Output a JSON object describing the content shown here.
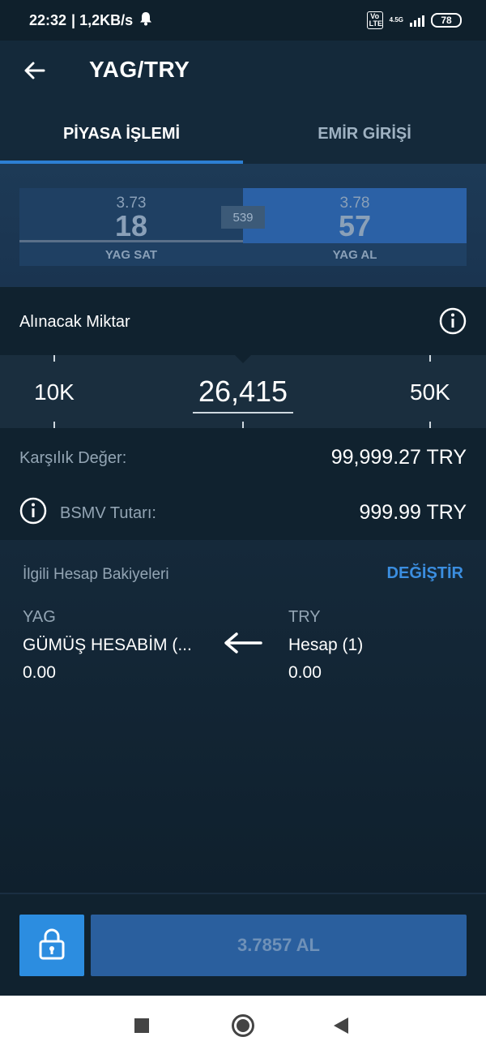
{
  "status_bar": {
    "time": "22:32",
    "network_speed": "| 1,2KB/s",
    "volte_label": "Vo LTE",
    "network_type": "4.5G",
    "battery": "78"
  },
  "header": {
    "title": "YAG/TRY"
  },
  "tabs": [
    {
      "label": "PİYASA İŞLEMİ",
      "active": true
    },
    {
      "label": "EMİR GİRİŞİ",
      "active": false
    }
  ],
  "quote": {
    "sell": {
      "price": "3.73",
      "pips": "18",
      "label": "YAG SAT"
    },
    "buy": {
      "price": "3.78",
      "pips": "57",
      "label": "YAG AL"
    },
    "spread": "539"
  },
  "amount": {
    "label": "Alınacak Miktar",
    "min": "10K",
    "max": "50K",
    "value": "26,415"
  },
  "values": {
    "counter_label": "Karşılık Değer:",
    "counter_value": "99,999.27 TRY",
    "bsmv_label": "BSMV Tutarı:",
    "bsmv_value": "999.99 TRY"
  },
  "balances": {
    "title": "İlgili Hesap Bakiyeleri",
    "change_label": "DEĞİŞTİR",
    "from": {
      "currency": "YAG",
      "account": "GÜMÜŞ HESABİM (...",
      "amount": "0.00"
    },
    "to": {
      "currency": "TRY",
      "account": "Hesap (1)",
      "amount": "0.00"
    }
  },
  "footer": {
    "buy_label": "3.7857 AL"
  },
  "colors": {
    "accent": "#2d7fd3",
    "link": "#3b8ee0",
    "background": "#10222f"
  }
}
